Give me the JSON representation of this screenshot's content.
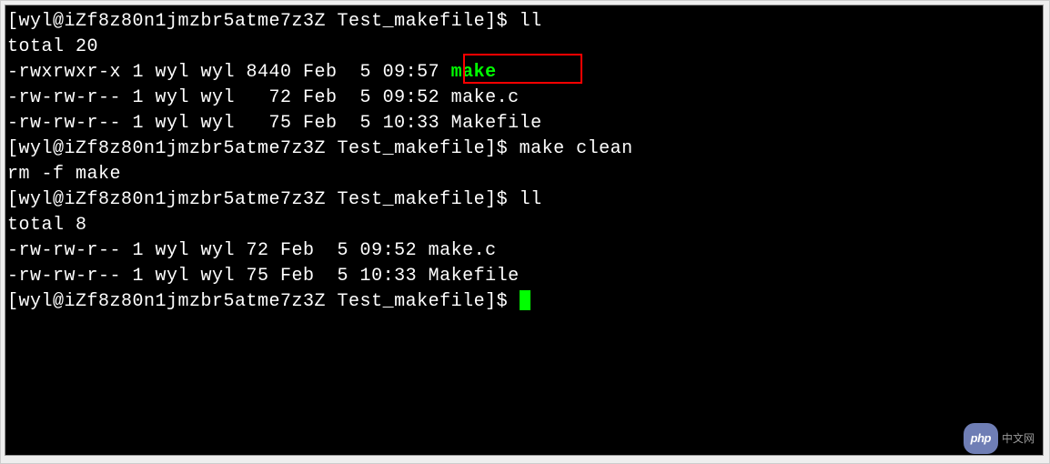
{
  "terminal": {
    "lines": [
      {
        "prompt": "[wyl@iZf8z80n1jmzbr5atme7z3Z Test_makefile]$ ",
        "cmd": "ll"
      },
      {
        "text": "total 20"
      },
      {
        "text": "-rwxrwxr-x 1 wyl wyl 8440 Feb  5 09:57 ",
        "exec": "make"
      },
      {
        "text": "-rw-rw-r-- 1 wyl wyl   72 Feb  5 09:52 make.c"
      },
      {
        "text": "-rw-rw-r-- 1 wyl wyl   75 Feb  5 10:33 Makefile"
      },
      {
        "prompt": "[wyl@iZf8z80n1jmzbr5atme7z3Z Test_makefile]$ ",
        "cmd": "make clean"
      },
      {
        "text": "rm -f make"
      },
      {
        "prompt": "[wyl@iZf8z80n1jmzbr5atme7z3Z Test_makefile]$ ",
        "cmd": "ll"
      },
      {
        "text": "total 8"
      },
      {
        "text": "-rw-rw-r-- 1 wyl wyl 72 Feb  5 09:52 make.c"
      },
      {
        "text": "-rw-rw-r-- 1 wyl wyl 75 Feb  5 10:33 Makefile"
      },
      {
        "prompt": "[wyl@iZf8z80n1jmzbr5atme7z3Z Test_makefile]$ ",
        "cursor": true
      }
    ]
  },
  "watermark": {
    "badge": "php",
    "text": "中文网"
  }
}
